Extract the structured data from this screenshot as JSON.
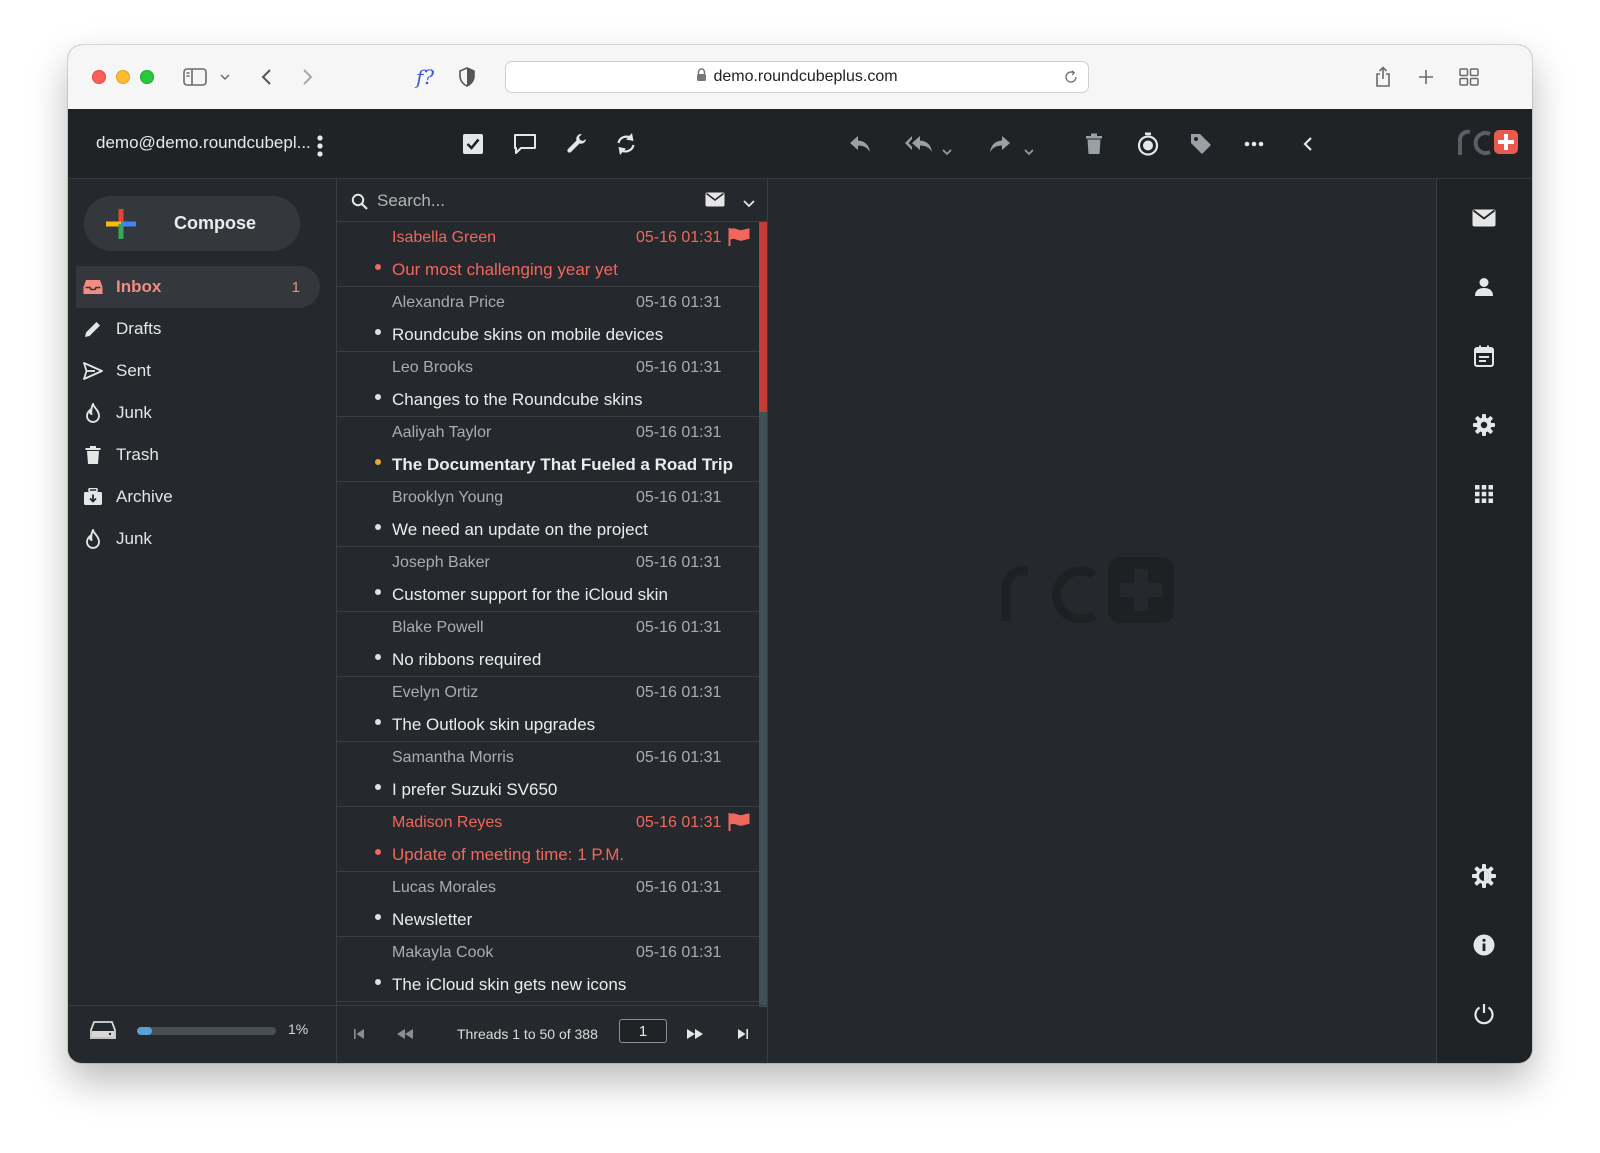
{
  "browser": {
    "url": "demo.roundcubeplus.com",
    "icons": [
      "sidebar-toggle-icon",
      "chevron-down-icon",
      "back-icon",
      "forward-icon",
      "fq-icon",
      "shield-icon",
      "lock-icon",
      "reload-icon",
      "share-icon",
      "new-tab-icon",
      "tab-overview-icon"
    ],
    "fq_label": "f?"
  },
  "header": {
    "account": "demo@demo.roundcubepl...",
    "toolbar_icons": [
      "select-icon",
      "threads-icon",
      "options-icon",
      "refresh-icon",
      "reply-icon",
      "reply-all-icon",
      "forward-icon",
      "delete-icon",
      "snooze-icon",
      "tag-icon",
      "more-icon",
      "collapse-icon"
    ]
  },
  "sidebar": {
    "compose_label": "Compose",
    "folders": [
      {
        "name": "Inbox",
        "count": "1",
        "icon": "inbox-icon",
        "active": true
      },
      {
        "name": "Drafts",
        "count": "",
        "icon": "pencil-icon"
      },
      {
        "name": "Sent",
        "count": "",
        "icon": "send-icon"
      },
      {
        "name": "Junk",
        "count": "",
        "icon": "fire-icon"
      },
      {
        "name": "Trash",
        "count": "",
        "icon": "trash-icon"
      },
      {
        "name": "Archive",
        "count": "",
        "icon": "archive-icon"
      },
      {
        "name": "Junk",
        "count": "",
        "icon": "fire-icon"
      }
    ],
    "quota_percent": 1,
    "quota_label": "1%"
  },
  "search": {
    "placeholder": "Search..."
  },
  "messages": [
    {
      "from": "Isabella Green",
      "date": "05-16 01:31",
      "subject": "Our most challenging year yet",
      "flagged": true,
      "unread": false
    },
    {
      "from": "Alexandra Price",
      "date": "05-16 01:31",
      "subject": "Roundcube skins on mobile devices",
      "flagged": false,
      "unread": false
    },
    {
      "from": "Leo Brooks",
      "date": "05-16 01:31",
      "subject": "Changes to the Roundcube skins",
      "flagged": false,
      "unread": false
    },
    {
      "from": "Aaliyah Taylor",
      "date": "05-16 01:31",
      "subject": "The Documentary That Fueled a Road Trip",
      "flagged": false,
      "unread": true
    },
    {
      "from": "Brooklyn Young",
      "date": "05-16 01:31",
      "subject": "We need an update on the project",
      "flagged": false,
      "unread": false
    },
    {
      "from": "Joseph Baker",
      "date": "05-16 01:31",
      "subject": "Customer support for the iCloud skin",
      "flagged": false,
      "unread": false
    },
    {
      "from": "Blake Powell",
      "date": "05-16 01:31",
      "subject": "No ribbons required",
      "flagged": false,
      "unread": false
    },
    {
      "from": "Evelyn Ortiz",
      "date": "05-16 01:31",
      "subject": "The Outlook skin upgrades",
      "flagged": false,
      "unread": false
    },
    {
      "from": "Samantha Morris",
      "date": "05-16 01:31",
      "subject": "I prefer Suzuki SV650",
      "flagged": false,
      "unread": false
    },
    {
      "from": "Madison Reyes",
      "date": "05-16 01:31",
      "subject": "Update of meeting time: 1 P.M.",
      "flagged": true,
      "unread": false
    },
    {
      "from": "Lucas Morales",
      "date": "05-16 01:31",
      "subject": "Newsletter",
      "flagged": false,
      "unread": false
    },
    {
      "from": "Makayla Cook",
      "date": "05-16 01:31",
      "subject": "The iCloud skin gets new icons",
      "flagged": false,
      "unread": false
    }
  ],
  "pager": {
    "label": "Threads 1 to 50 of 388",
    "page": "1"
  },
  "taskbar": [
    "mail-icon",
    "contacts-icon",
    "calendar-icon",
    "settings-icon",
    "apps-icon",
    "theme-icon",
    "about-icon",
    "logout-icon"
  ],
  "colors": {
    "accent": "#f28b82",
    "flagged": "#f0675c",
    "unread_dot": "#e6a83a",
    "background": "#25282c",
    "header": "#202326"
  }
}
